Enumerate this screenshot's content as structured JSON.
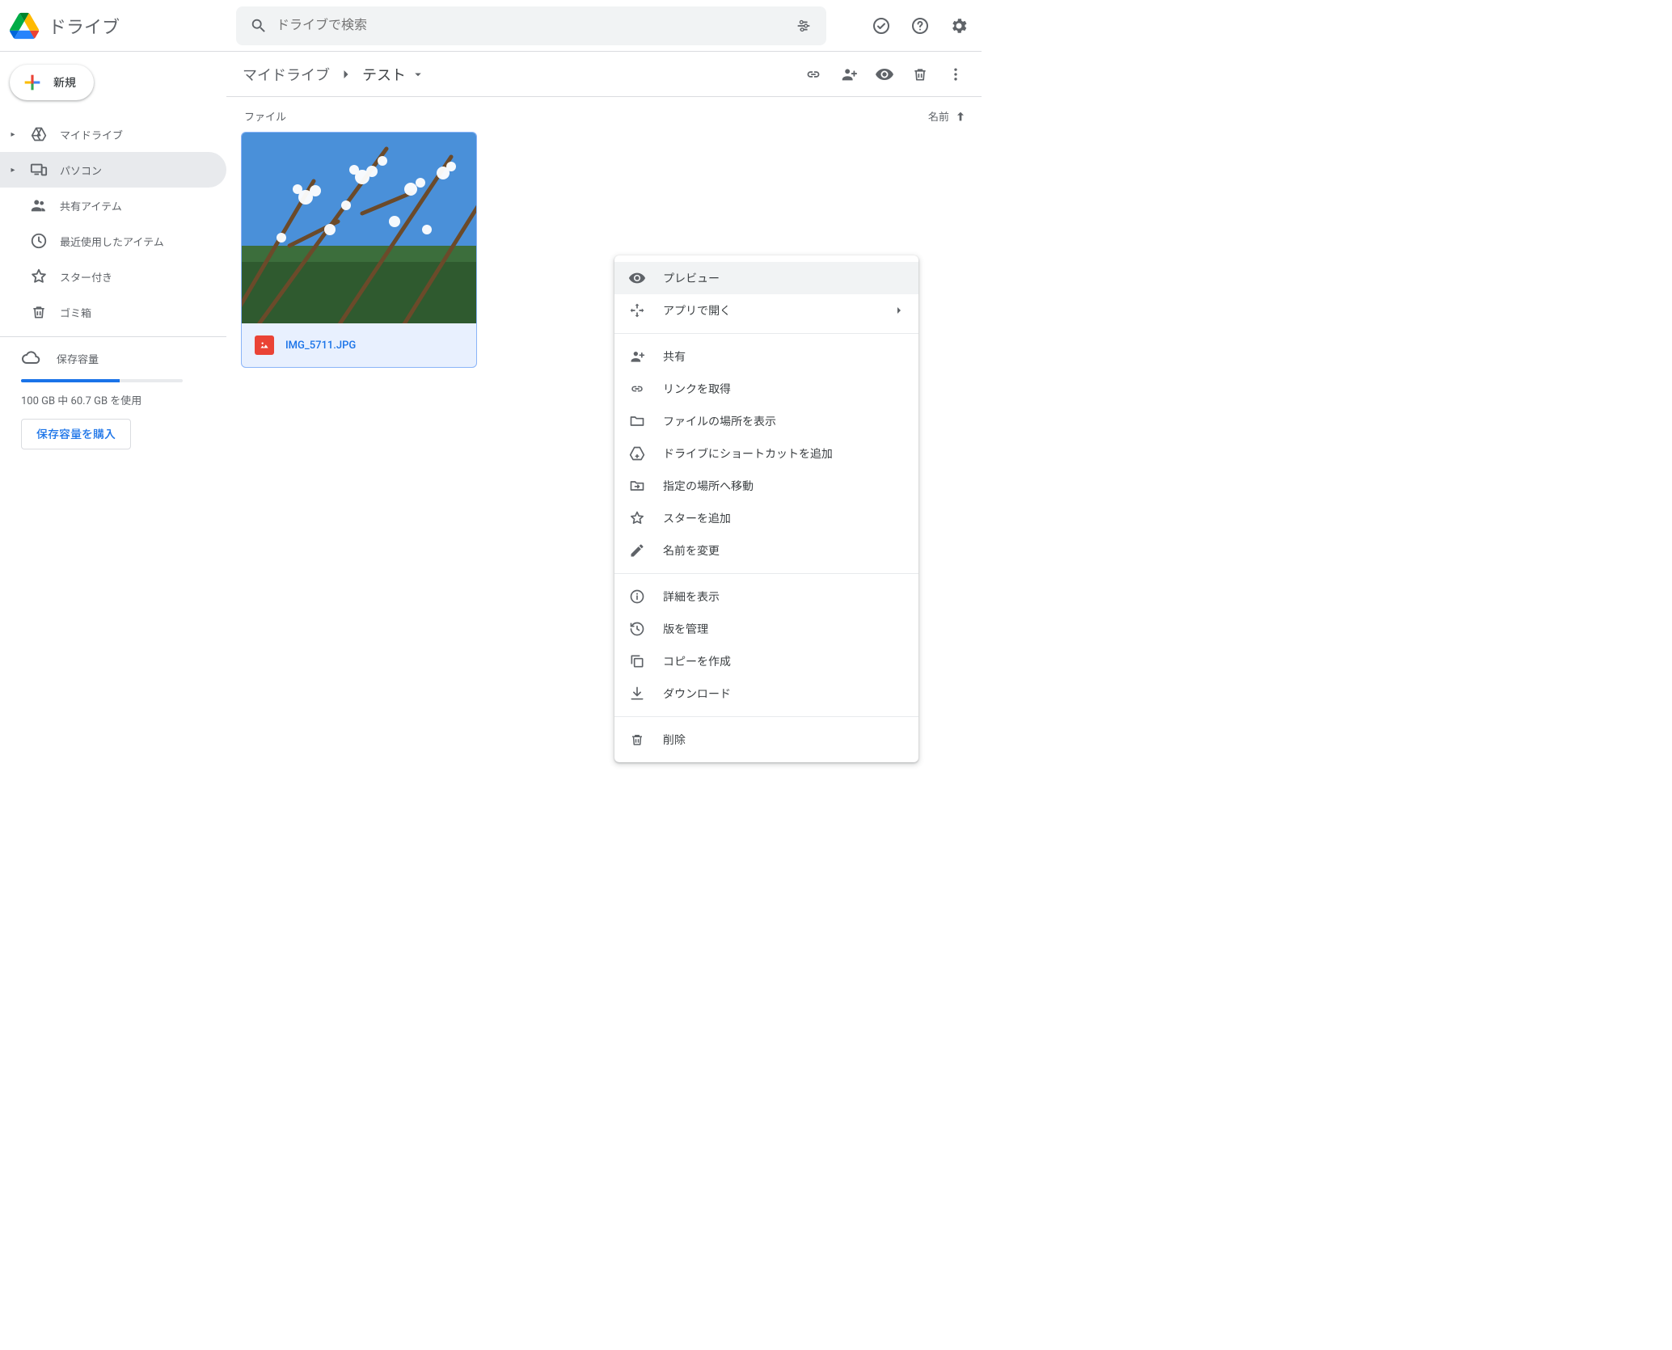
{
  "app": {
    "name": "ドライブ"
  },
  "search": {
    "placeholder": "ドライブで検索"
  },
  "new_button": {
    "label": "新規"
  },
  "sidebar": {
    "items": [
      {
        "id": "my-drive",
        "label": "マイドライブ",
        "expandable": true
      },
      {
        "id": "computers",
        "label": "パソコン",
        "expandable": true,
        "active": true
      },
      {
        "id": "shared",
        "label": "共有アイテム"
      },
      {
        "id": "recent",
        "label": "最近使用したアイテム"
      },
      {
        "id": "starred",
        "label": "スター付き"
      },
      {
        "id": "trash",
        "label": "ゴミ箱"
      }
    ]
  },
  "storage": {
    "label": "保存容量",
    "used_text": "100 GB 中 60.7 GB を使用",
    "used_gb": 60.7,
    "total_gb": 100,
    "percent": 61,
    "buy_label": "保存容量を購入"
  },
  "breadcrumbs": [
    {
      "label": "マイドライブ"
    },
    {
      "label": "テスト",
      "current": true
    }
  ],
  "section": {
    "label": "ファイル"
  },
  "sort": {
    "label": "名前"
  },
  "files": [
    {
      "name": "IMG_5711.JPG",
      "type": "image",
      "selected": true
    }
  ],
  "context_menu": {
    "groups": [
      [
        {
          "id": "preview",
          "label": "プレビュー",
          "icon": "eye",
          "hover": true
        },
        {
          "id": "open-with",
          "label": "アプリで開く",
          "icon": "open-with",
          "submenu": true
        }
      ],
      [
        {
          "id": "share",
          "label": "共有",
          "icon": "person-add"
        },
        {
          "id": "get-link",
          "label": "リンクを取得",
          "icon": "link"
        },
        {
          "id": "show-location",
          "label": "ファイルの場所を表示",
          "icon": "folder"
        },
        {
          "id": "add-shortcut",
          "label": "ドライブにショートカットを追加",
          "icon": "shortcut"
        },
        {
          "id": "move",
          "label": "指定の場所へ移動",
          "icon": "move"
        },
        {
          "id": "add-star",
          "label": "スターを追加",
          "icon": "star"
        },
        {
          "id": "rename",
          "label": "名前を変更",
          "icon": "pencil"
        }
      ],
      [
        {
          "id": "details",
          "label": "詳細を表示",
          "icon": "info"
        },
        {
          "id": "versions",
          "label": "版を管理",
          "icon": "history"
        },
        {
          "id": "copy",
          "label": "コピーを作成",
          "icon": "copy"
        },
        {
          "id": "download",
          "label": "ダウンロード",
          "icon": "download"
        }
      ],
      [
        {
          "id": "delete",
          "label": "削除",
          "icon": "trash"
        }
      ]
    ]
  },
  "colors": {
    "accent": "#1a73e8",
    "danger": "#ea4335",
    "icon": "#5f6368",
    "border": "#dadce0",
    "hover": "#f1f3f4",
    "selected": "#e8f0fe"
  }
}
